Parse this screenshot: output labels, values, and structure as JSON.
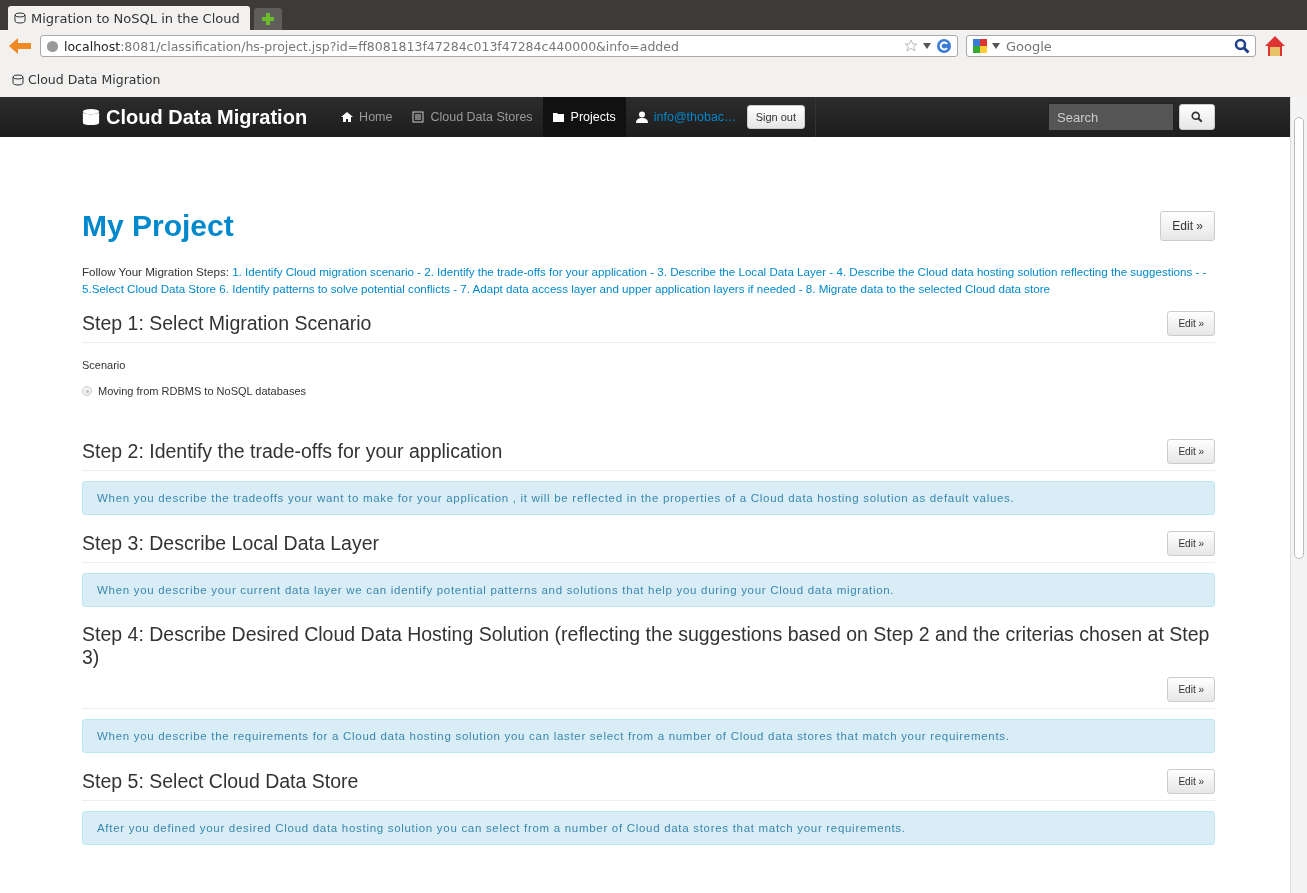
{
  "browser": {
    "tab_title": "Migration to NoSQL in the Cloud",
    "url_host": "localhost",
    "url_rest": ":8081/classification/hs-project.jsp?id=ff8081813f47284c013f47284c440000&info=added",
    "search_placeholder": "Google",
    "bookmark": "Cloud Data Migration"
  },
  "navbar": {
    "brand": "Cloud Data Migration",
    "items": [
      {
        "label": "Home",
        "selected": false
      },
      {
        "label": "Cloud Data Stores",
        "selected": false
      },
      {
        "label": "Projects",
        "selected": true
      }
    ],
    "user": "info@thobac…",
    "sign_out": "Sign out",
    "search_placeholder": "Search"
  },
  "page": {
    "title": "My Project",
    "edit": "Edit »",
    "steps_label": "Follow Your Migration Steps:",
    "steps_text": "1. Identify Cloud migration scenario - 2. Identify the trade-offs for your application - 3. Describe the Local Data Layer - 4. Describe the Cloud data hosting solution reflecting the suggestions - - 5.Select Cloud Data Store 6. Identify patterns to solve potential conflicts - 7. Adapt data access layer and upper application layers if needed - 8. Migrate data to the selected Cloud data store"
  },
  "steps": [
    {
      "title": "Step 1: Select Migration Scenario",
      "edit": "Edit »",
      "kind": "scenario",
      "label": "Scenario",
      "option": "Moving from RDBMS to NoSQL databases",
      "checked": true
    },
    {
      "title": "Step 2: Identify the trade-offs for your application",
      "edit": "Edit »",
      "kind": "info",
      "text": "When you describe the tradeoffs your want to make for your application , it will be reflected in the properties of a Cloud data hosting solution as default values."
    },
    {
      "title": "Step 3: Describe Local Data Layer",
      "edit": "Edit »",
      "kind": "info",
      "text": "When you describe your current data layer we can identify potential patterns and solutions that help you during your Cloud data migration."
    },
    {
      "title": "Step 4: Describe Desired Cloud Data Hosting Solution (reflecting the suggestions based on Step 2 and the criterias chosen at Step 3)",
      "edit": "Edit »",
      "kind": "info",
      "text": "When you describe the requirements for a Cloud data hosting solution you can laster select from a number of Cloud data stores that match your requirements."
    },
    {
      "title": "Step 5: Select Cloud Data Store",
      "edit": "Edit »",
      "kind": "info",
      "text": "After you defined your desired Cloud data hosting solution you can select from a number of Cloud data stores that match your requirements."
    }
  ]
}
